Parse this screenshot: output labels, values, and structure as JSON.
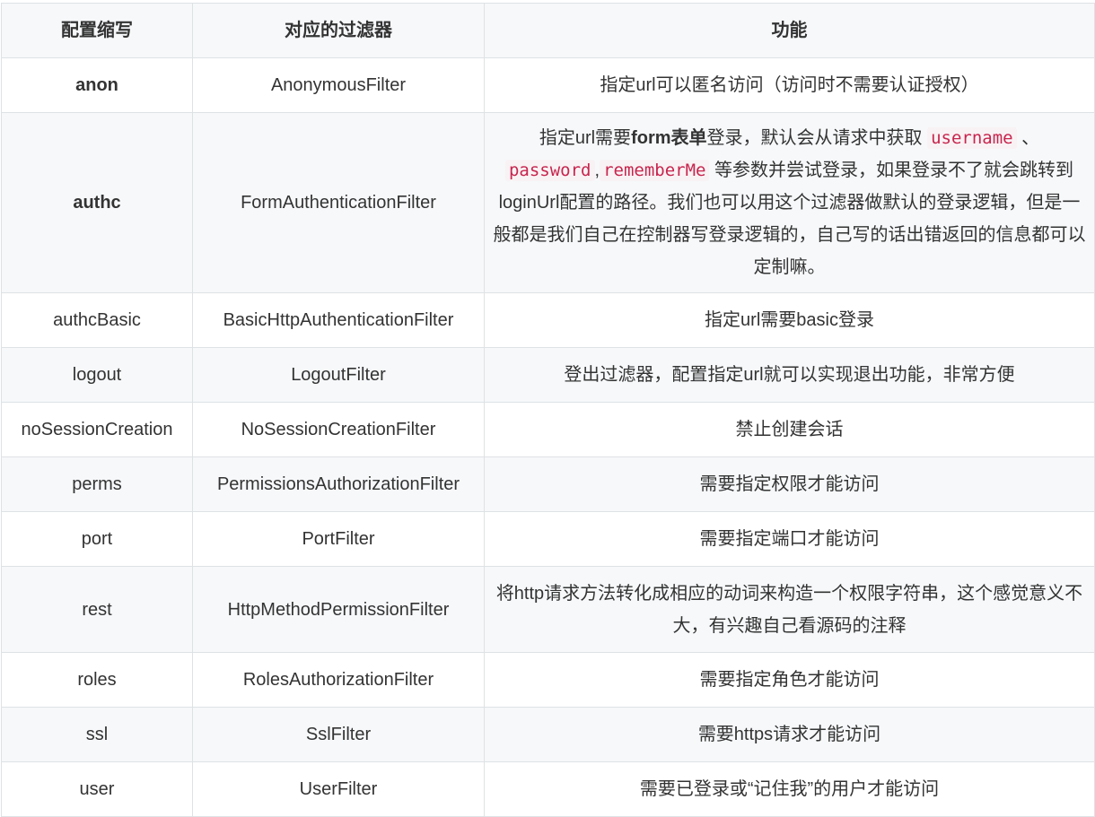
{
  "headers": [
    "配置缩写",
    "对应的过滤器",
    "功能"
  ],
  "rows": [
    {
      "abbr": "anon",
      "filter": "AnonymousFilter",
      "desc": "指定url可以匿名访问（访问时不需要认证授权）"
    },
    {
      "abbr": "authc",
      "filter": "FormAuthenticationFilter",
      "desc_parts": {
        "p1": "指定url需要",
        "b1": "form表单",
        "p2": "登录，默认会从请求中获取",
        "c1": "username",
        "p3": "、",
        "c2": "password",
        "p4": ",",
        "c3": "rememberMe",
        "p5": "等参数并尝试登录，如果登录不了就会跳转到loginUrl配置的路径。我们也可以用这个过滤器做默认的登录逻辑，但是一般都是我们自己在控制器写登录逻辑的，自己写的话出错返回的信息都可以定制嘛。"
      }
    },
    {
      "abbr": "authcBasic",
      "filter": "BasicHttpAuthenticationFilter",
      "desc": "指定url需要basic登录"
    },
    {
      "abbr": "logout",
      "filter": "LogoutFilter",
      "desc": "登出过滤器，配置指定url就可以实现退出功能，非常方便"
    },
    {
      "abbr": "noSessionCreation",
      "filter": "NoSessionCreationFilter",
      "desc": "禁止创建会话"
    },
    {
      "abbr": "perms",
      "filter": "PermissionsAuthorizationFilter",
      "desc": "需要指定权限才能访问"
    },
    {
      "abbr": "port",
      "filter": "PortFilter",
      "desc": "需要指定端口才能访问"
    },
    {
      "abbr": "rest",
      "filter": "HttpMethodPermissionFilter",
      "desc": "将http请求方法转化成相应的动词来构造一个权限字符串，这个感觉意义不大，有兴趣自己看源码的注释"
    },
    {
      "abbr": "roles",
      "filter": "RolesAuthorizationFilter",
      "desc": "需要指定角色才能访问"
    },
    {
      "abbr": "ssl",
      "filter": "SslFilter",
      "desc": "需要https请求才能访问"
    },
    {
      "abbr": "user",
      "filter": "UserFilter",
      "desc": "需要已登录或“记住我”的用户才能访问"
    }
  ]
}
